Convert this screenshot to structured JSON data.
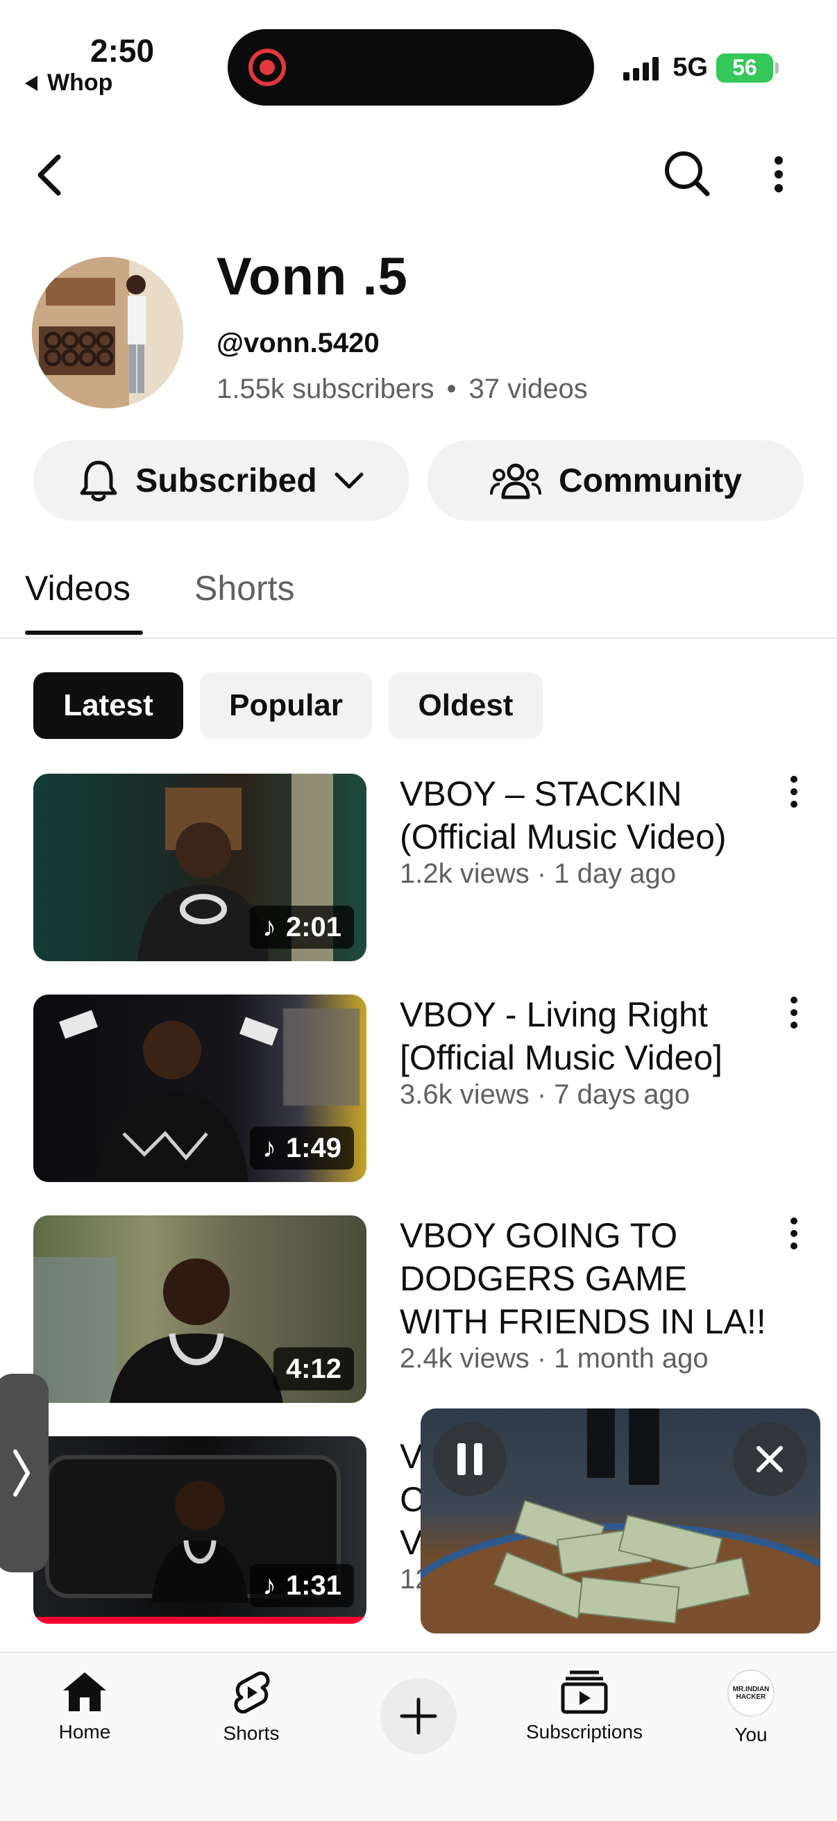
{
  "status_bar": {
    "time": "2:50",
    "back_app": "Whop",
    "network": "5G",
    "battery": "56"
  },
  "appbar": {
    "back_icon": "back-arrow-icon",
    "search_icon": "search-icon",
    "more_icon": "more-vertical-icon"
  },
  "channel": {
    "name": "Vonn .5",
    "handle": "@vonn.5420",
    "subscribers": "1.55k subscribers",
    "separator": "•",
    "videos_count": "37 videos",
    "subscribe_label": "Subscribed",
    "community_label": "Community"
  },
  "tabs": [
    "Videos",
    "Shorts"
  ],
  "active_tab": "Videos",
  "filters": [
    "Latest",
    "Popular",
    "Oldest"
  ],
  "active_filter": "Latest",
  "videos": [
    {
      "title": "VBOY – STACKIN (Official Music Video)",
      "meta": "1.2k views · 1 day ago",
      "duration": "2:01",
      "music": true
    },
    {
      "title": "VBOY - Living Right [Official Music Video]",
      "meta": "3.6k views · 7 days ago",
      "duration": "1:49",
      "music": true
    },
    {
      "title": "VBOY GOING TO DODGERS GAME WITH FRIENDS IN LA!!",
      "meta": "2.4k views · 1 month ago",
      "duration": "4:12",
      "music": false
    },
    {
      "title": "V",
      "title_line2": "C",
      "title_line3": "V",
      "meta": "12",
      "duration": "1:31",
      "music": true
    }
  ],
  "mini_player": {
    "pause_icon": "pause-icon",
    "close_icon": "close-icon"
  },
  "bottom_nav": {
    "home": "Home",
    "shorts": "Shorts",
    "subscriptions": "Subscriptions",
    "you": "You",
    "you_avatar_text": "MR.INDIAN HACKER"
  },
  "colors": {
    "accent_red": "#ff0033",
    "battery_green": "#34c759"
  }
}
